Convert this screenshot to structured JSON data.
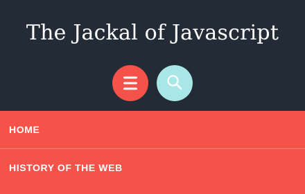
{
  "header": {
    "site_title": "The Jackal of Javascript",
    "menu_toggle": {
      "icon": "hamburger-icon",
      "color": "#f5534a"
    },
    "search_toggle": {
      "icon": "search-icon",
      "color": "#a9e6e6"
    }
  },
  "nav": {
    "background": "#f5534a",
    "items": [
      {
        "label": "HOME"
      },
      {
        "label": "HISTORY OF THE WEB"
      }
    ]
  },
  "colors": {
    "header_background": "#232b36",
    "text": "#ffffff"
  }
}
